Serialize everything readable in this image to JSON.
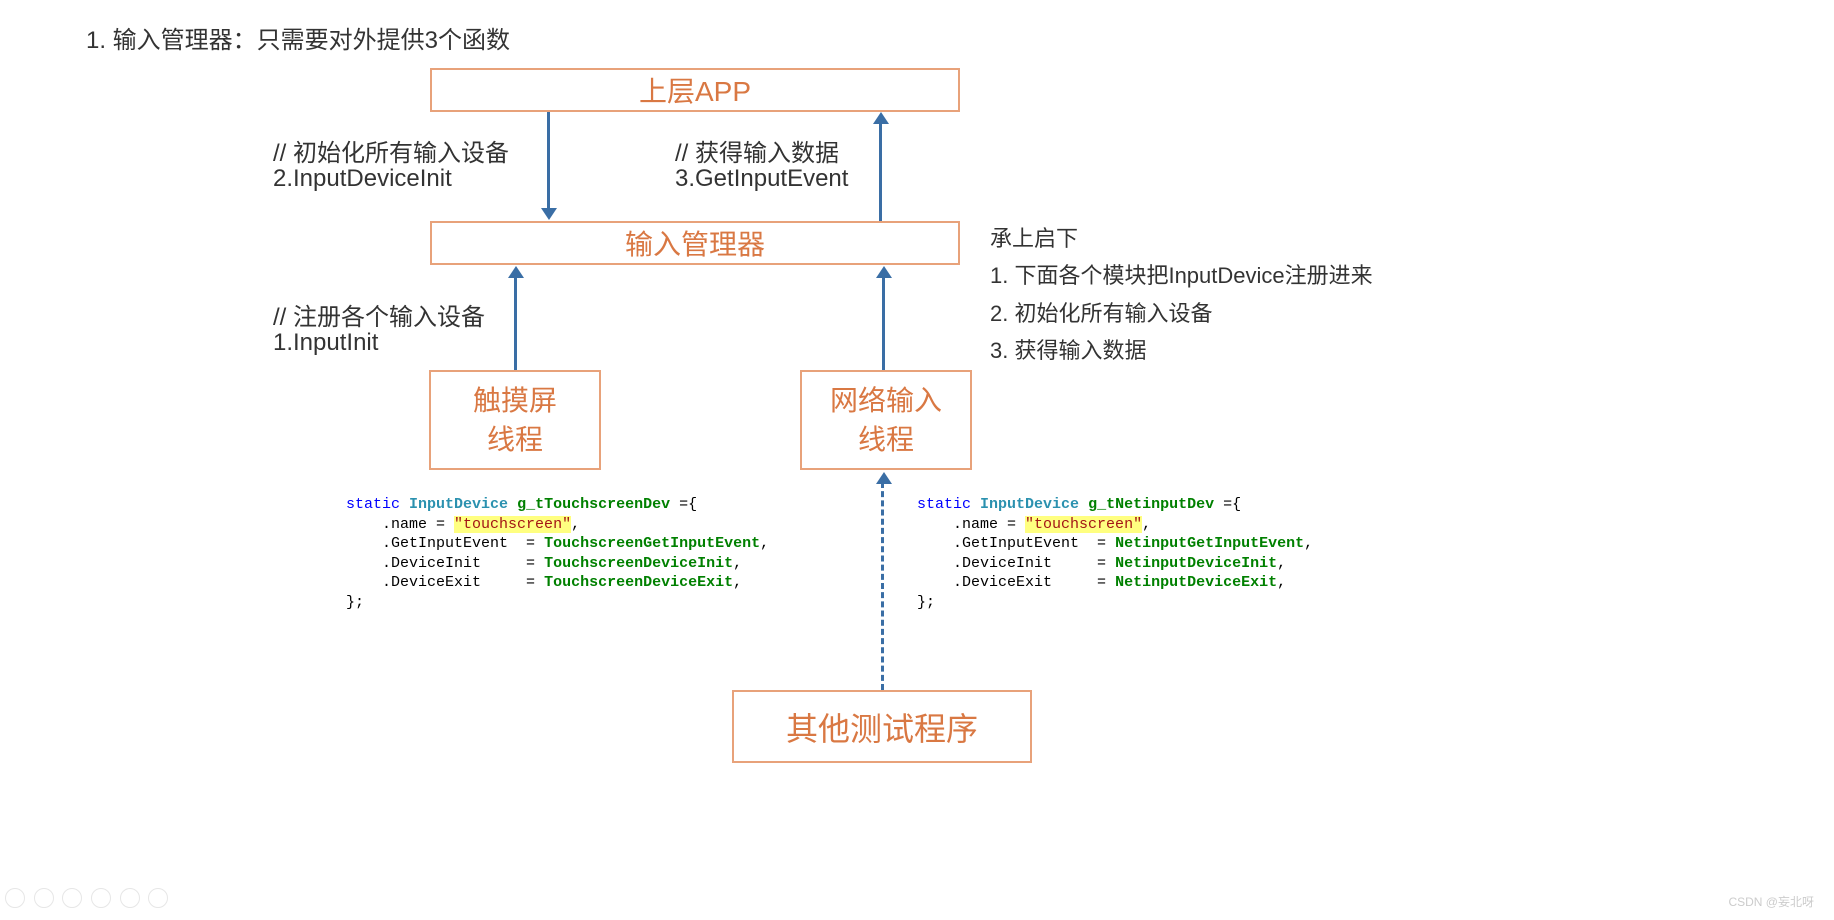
{
  "title": "1. 输入管理器：只需要对外提供3个函数",
  "boxes": {
    "app": "上层APP",
    "manager": "输入管理器",
    "touch": "触摸屏\n线程",
    "net": "网络输入\n线程",
    "other": "其他测试程序"
  },
  "labels": {
    "left1": "// 初始化所有输入设备",
    "left1b": "2.InputDeviceInit",
    "right1": "// 获得输入数据",
    "right1b": "3.GetInputEvent",
    "left2": "// 注册各个输入设备",
    "left2b": "1.InputInit"
  },
  "side": {
    "h": "承上启下",
    "l1": "1. 下面各个模块把InputDevice注册进来",
    "l2": "2. 初始化所有输入设备",
    "l3": "3. 获得输入数据"
  },
  "code_touch": {
    "static": "static",
    "type": "InputDevice",
    "var": "g_tTouchscreenDev",
    "eq": " ={",
    "name_k": ".name",
    "name_v": "\"touchscreen\"",
    "f1k": ".GetInputEvent",
    "f1v": "TouchscreenGetInputEvent",
    "f2k": ".DeviceInit",
    "f2v": "TouchscreenDeviceInit",
    "f3k": ".DeviceExit",
    "f3v": "TouchscreenDeviceExit",
    "end": "};"
  },
  "code_net": {
    "static": "static",
    "type": "InputDevice",
    "var": "g_tNetinputDev",
    "eq": " ={",
    "name_k": ".name",
    "name_v": "\"touchscreen\"",
    "f1k": ".GetInputEvent",
    "f1v": "NetinputGetInputEvent",
    "f2k": ".DeviceInit",
    "f2v": "NetinputDeviceInit",
    "f3k": ".DeviceExit",
    "f3v": "NetinputDeviceExit",
    "end": "};"
  },
  "watermark": "CSDN @妄北呀"
}
